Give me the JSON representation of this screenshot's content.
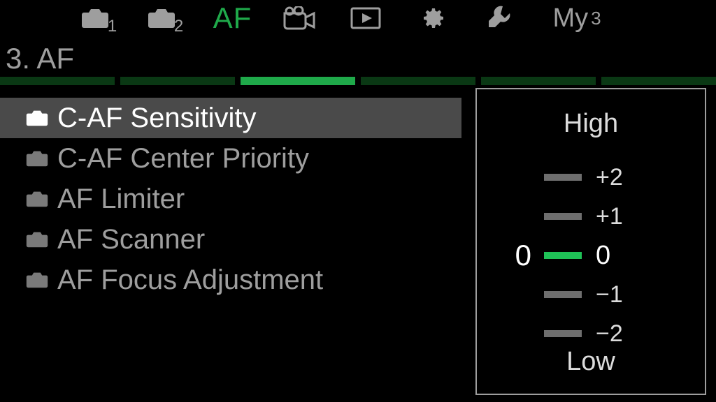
{
  "colors": {
    "accent": "#1fa94a",
    "accent_bright": "#1fc257",
    "dim_green": "#0a3814",
    "grey": "#9e9e9e",
    "sel_bg": "#4a4a4a"
  },
  "tabs": {
    "cam1_sub": "1",
    "cam2_sub": "2",
    "af_label": "AF",
    "my_label": "My",
    "my_sup": "3",
    "active_index": 2
  },
  "section_title": "3. AF",
  "strip_segments": 6,
  "strip_active_index": 2,
  "menu": {
    "items": [
      {
        "label": "C-AF Sensitivity",
        "selected": true
      },
      {
        "label": "C-AF Center Priority",
        "selected": false
      },
      {
        "label": "AF Limiter",
        "selected": false
      },
      {
        "label": "AF Scanner",
        "selected": false
      },
      {
        "label": "AF Focus Adjustment",
        "selected": false
      }
    ]
  },
  "panel": {
    "high_label": "High",
    "low_label": "Low",
    "current_value": "0",
    "scale": [
      {
        "label": "+2",
        "active": false
      },
      {
        "label": "+1",
        "active": false
      },
      {
        "label": "0",
        "active": true
      },
      {
        "label": "−1",
        "active": false
      },
      {
        "label": "−2",
        "active": false
      }
    ]
  }
}
